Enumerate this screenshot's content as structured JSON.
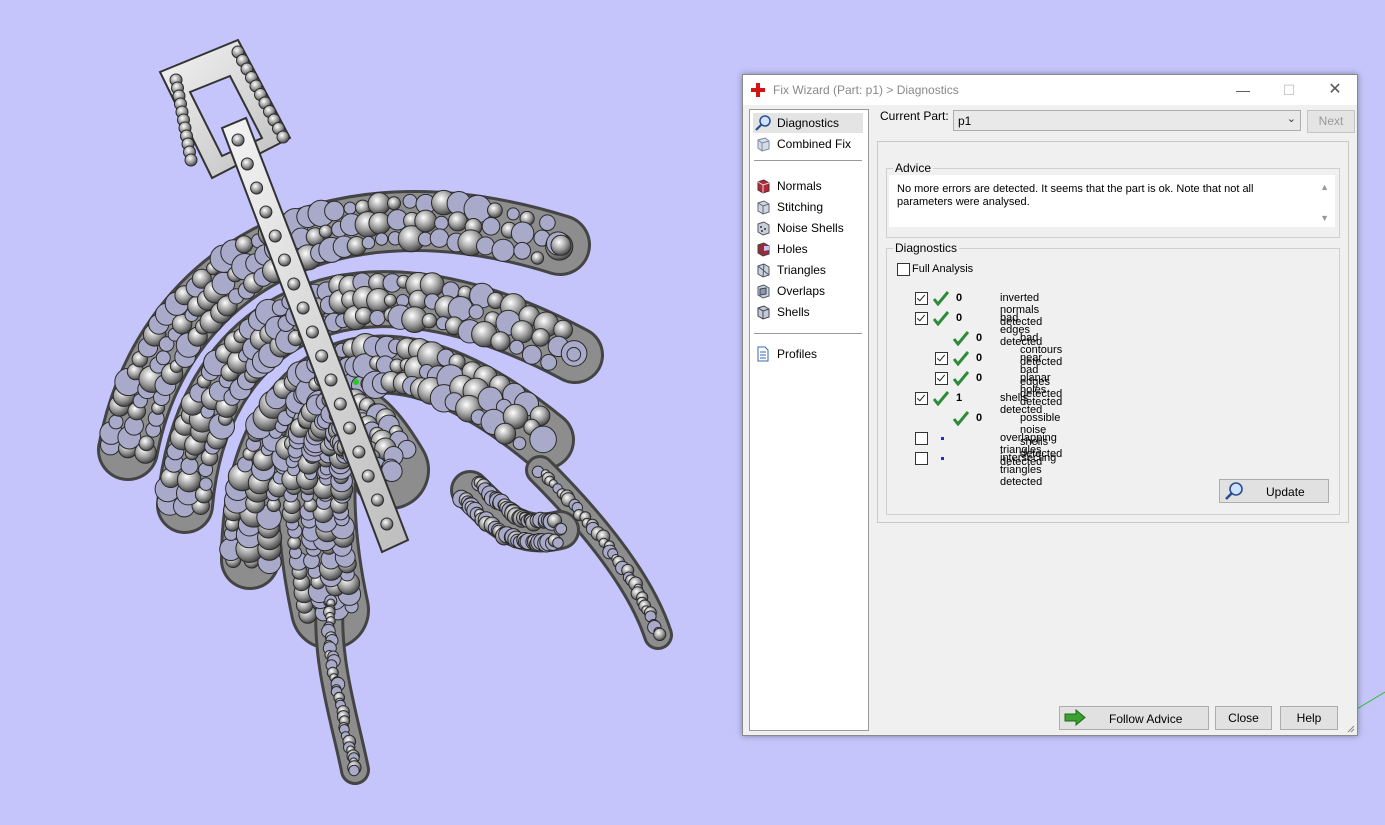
{
  "dialog": {
    "title": "Fix Wizard (Part: p1) > Diagnostics",
    "current_part_label": "Current Part:",
    "current_part_value": "p1",
    "next_label": "Next"
  },
  "nav": {
    "top": [
      {
        "label": "Diagnostics",
        "icon": "magnifier-icon"
      },
      {
        "label": "Combined Fix",
        "icon": "cube-fix-icon"
      }
    ],
    "middle": [
      {
        "label": "Normals",
        "icon": "normals-icon"
      },
      {
        "label": "Stitching",
        "icon": "stitching-icon"
      },
      {
        "label": "Noise Shells",
        "icon": "noise-shells-icon"
      },
      {
        "label": "Holes",
        "icon": "holes-icon"
      },
      {
        "label": "Triangles",
        "icon": "triangles-icon"
      },
      {
        "label": "Overlaps",
        "icon": "overlaps-icon"
      },
      {
        "label": "Shells",
        "icon": "shells-icon"
      }
    ],
    "bottom": [
      {
        "label": "Profiles",
        "icon": "document-icon"
      }
    ]
  },
  "advice": {
    "title": "Advice",
    "text": "No more errors are detected. It seems that the part is ok. Note that not all parameters were analysed."
  },
  "diagnostics": {
    "title": "Diagnostics",
    "full_analysis_label": "Full Analysis",
    "rows": [
      {
        "count": "0",
        "label": "inverted normals detected"
      },
      {
        "count": "0",
        "label": "bad edges detected"
      },
      {
        "count": "0",
        "label": "bad contours detected"
      },
      {
        "count": "0",
        "label": "near bad edges detected"
      },
      {
        "count": "0",
        "label": "planar holes detected"
      },
      {
        "count": "1",
        "label": "shells detected"
      },
      {
        "count": "0",
        "label": "possible noise shells detected"
      },
      {
        "count": "",
        "label": "overlapping triangles detected"
      },
      {
        "count": "",
        "label": "intersecting triangles detected"
      }
    ]
  },
  "buttons": {
    "update": "Update",
    "follow_advice": "Follow Advice",
    "close": "Close",
    "help": "Help"
  },
  "colors": {
    "background": "#c5c5fb",
    "tick": "#2e8b3a",
    "arrow": "#3aa030",
    "title_icon": "#d21414"
  }
}
